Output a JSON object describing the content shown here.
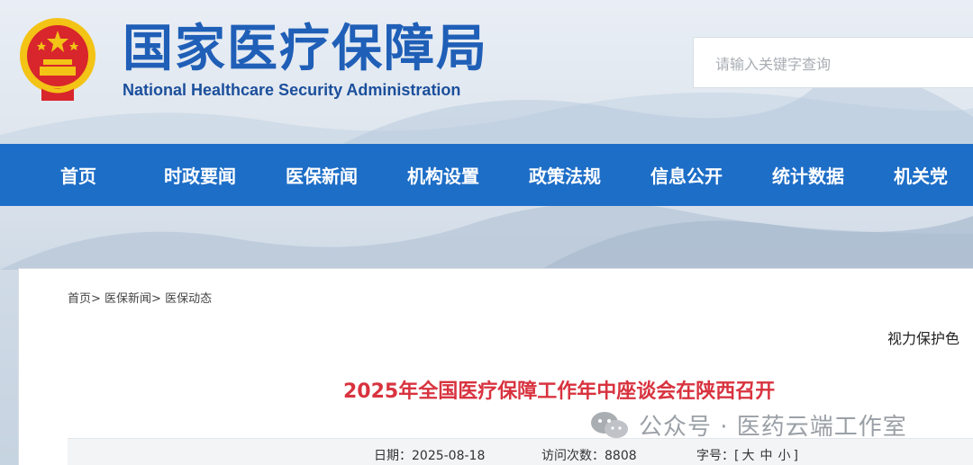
{
  "header": {
    "title_cn": "国家医疗保障局",
    "title_en": "National Healthcare Security Administration",
    "search_placeholder": "请输入关键字查询"
  },
  "nav": {
    "items": [
      "首页",
      "时政要闻",
      "医保新闻",
      "机构设置",
      "政策法规",
      "信息公开",
      "统计数据",
      "机关党"
    ]
  },
  "breadcrumb": {
    "home": "首页>",
    "news": "医保新闻>",
    "current": "医保动态"
  },
  "tools": {
    "eye_protect": "视力保护色"
  },
  "article": {
    "title": "2025年全国医疗保障工作年中座谈会在陕西召开",
    "date_label": "日期：",
    "date": "2025-08-18",
    "visits_label": "访问次数：",
    "visits": "8808",
    "font_label": "字号：",
    "font_open": "[",
    "font_large": "大",
    "font_medium": "中",
    "font_small": "小",
    "font_close": "]"
  },
  "watermark": {
    "text": "公众号 · 医药云端工作室"
  },
  "colors": {
    "brand_blue": "#1f5fb7",
    "nav_blue": "#1d6ec7",
    "title_red": "#d8333f"
  }
}
